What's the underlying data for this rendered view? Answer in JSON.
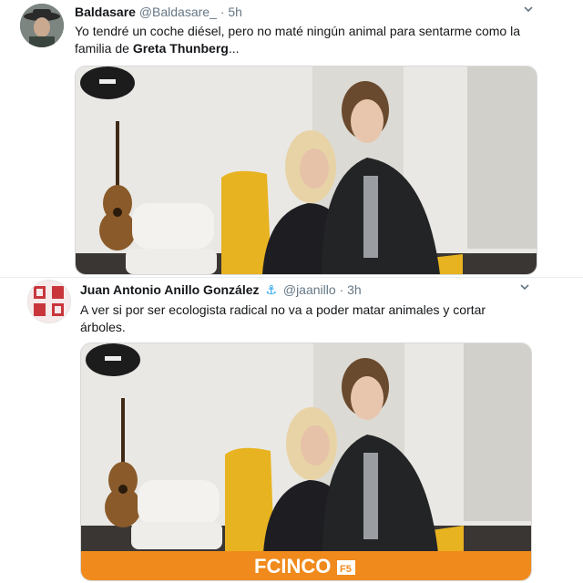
{
  "tweets": [
    {
      "author_name": "Baldasare",
      "handle": "@Baldasare_",
      "separator": "·",
      "time": "5h",
      "text_before": "Yo tendré un coche diésel, pero no maté ningún animal para sentarme como la familia de ",
      "text_bold": "Greta Thunberg",
      "text_after": "...",
      "menu_icon": "chevron-down-icon"
    },
    {
      "author_name": "Juan Antonio Anillo González",
      "verified_symbol": "⚓",
      "handle": "@jaanillo",
      "separator": "·",
      "time": "3h",
      "text": "A ver si por ser ecologista radical no va a poder matar animales y cortar árboles.",
      "menu_icon": "chevron-down-icon",
      "image_banner_text": "FCINCO",
      "image_banner_badge": "F5"
    }
  ],
  "colors": {
    "link_blue": "#1da1f2",
    "secondary_text": "#657786",
    "banner_orange": "#f08a1c",
    "chair_yellow": "#e8b320"
  }
}
